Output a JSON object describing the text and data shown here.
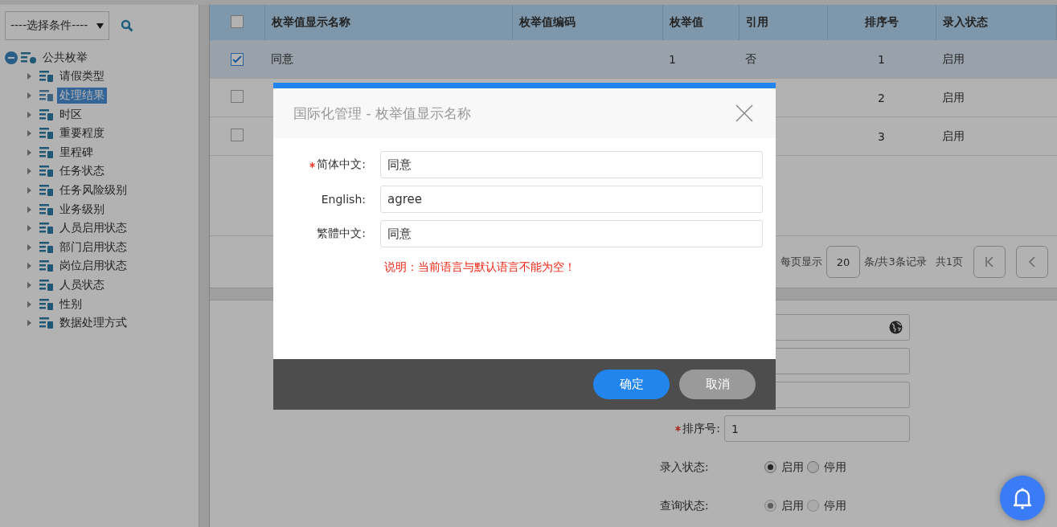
{
  "sidebar": {
    "filter": {
      "value": "----选择条件----"
    },
    "tree": {
      "label": "公共枚举",
      "expanded": true,
      "children": [
        {
          "label": "请假类型",
          "selected": false
        },
        {
          "label": "处理结果",
          "selected": true
        },
        {
          "label": "时区",
          "selected": false
        },
        {
          "label": "重要程度",
          "selected": false
        },
        {
          "label": "里程碑",
          "selected": false
        },
        {
          "label": "任务状态",
          "selected": false
        },
        {
          "label": "任务风险级别",
          "selected": false
        },
        {
          "label": "业务级别",
          "selected": false
        },
        {
          "label": "人员启用状态",
          "selected": false
        },
        {
          "label": "部门启用状态",
          "selected": false
        },
        {
          "label": "岗位启用状态",
          "selected": false
        },
        {
          "label": "人员状态",
          "selected": false
        },
        {
          "label": "性别",
          "selected": false
        },
        {
          "label": "数据处理方式",
          "selected": false
        }
      ]
    }
  },
  "table": {
    "header_checked": false,
    "columns": [
      "枚举值显示名称",
      "枚举值编码",
      "枚举值",
      "引用",
      "排序号",
      "录入状态"
    ],
    "rows": [
      {
        "checked": true,
        "selected": true,
        "name": "同意",
        "value": "1",
        "ref": "否",
        "order": "1",
        "status": "启用"
      },
      {
        "checked": false,
        "selected": false,
        "order": "2",
        "status": "启用"
      },
      {
        "checked": false,
        "selected": false,
        "order": "3",
        "status": "启用"
      }
    ]
  },
  "pager": {
    "per_page_label": "每页显示",
    "page_size": "20",
    "summary": "条/共3条记录",
    "pages": "共1页"
  },
  "form": {
    "fields": [
      {
        "kind": "i18n"
      },
      {
        "kind": "text"
      },
      {
        "kind": "text"
      },
      {
        "kind": "text",
        "label": "排序号:",
        "required": true,
        "value": "1"
      }
    ],
    "radio_groups": [
      {
        "label": "录入状态:",
        "disabled": false,
        "options": [
          {
            "label": "启用",
            "selected": true
          },
          {
            "label": "停用",
            "selected": false
          }
        ]
      },
      {
        "label": "查询状态:",
        "disabled": true,
        "options": [
          {
            "label": "启用",
            "selected": true
          },
          {
            "label": "停用",
            "selected": false
          }
        ]
      }
    ]
  },
  "dialog": {
    "title": "国际化管理 - 枚举值显示名称",
    "fields": [
      {
        "label": "简体中文:",
        "required": true,
        "value": "同意"
      },
      {
        "label": "English:",
        "required": false,
        "value": "agree"
      },
      {
        "label": "繁體中文:",
        "required": false,
        "value": "同意"
      }
    ],
    "note": "说明：当前语言与默认语言不能为空！",
    "buttons": [
      {
        "label": "确定",
        "kind": "primary"
      },
      {
        "label": "取消",
        "kind": "secondary"
      }
    ]
  }
}
